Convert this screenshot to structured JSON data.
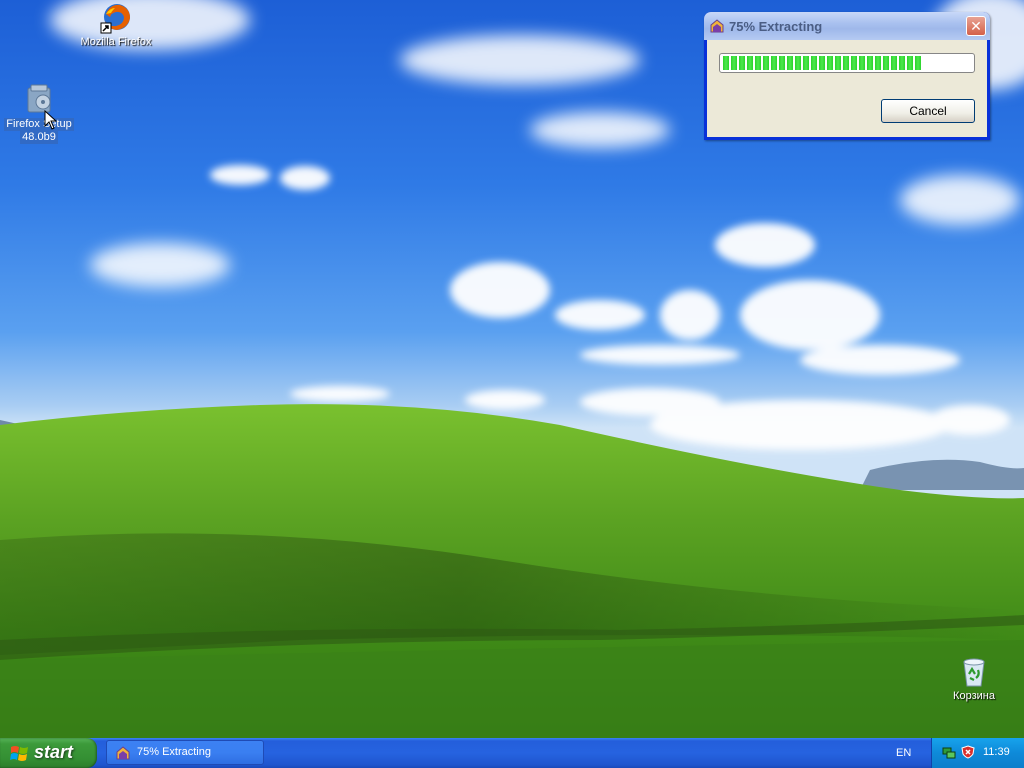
{
  "desktop": {
    "icons": [
      {
        "label": "Mozilla Firefox",
        "icon": "firefox-shortcut-icon"
      },
      {
        "label_line1": "Firefox Setup",
        "label_line2": "48.0b9",
        "icon": "setup-package-icon",
        "selected": true
      },
      {
        "label": "Корзина",
        "icon": "recycle-bin-icon"
      }
    ]
  },
  "dialog": {
    "title": "75% Extracting",
    "progress_fraction": 0.8,
    "cancel_label": "Cancel",
    "close_symbol": "✕"
  },
  "taskbar": {
    "start_label": "start",
    "task_items": [
      {
        "label": "75% Extracting",
        "icon": "installer-icon"
      }
    ],
    "language": "EN",
    "tray_icons": [
      "network-icon",
      "security-shield-icon"
    ],
    "clock": "11:39"
  },
  "colors": {
    "taskbar_blue": "#245edb",
    "start_green": "#3c9a3a",
    "dialog_frame": "#0831d9",
    "dialog_body": "#ece9d8",
    "progress_green": "#2bd32b"
  }
}
